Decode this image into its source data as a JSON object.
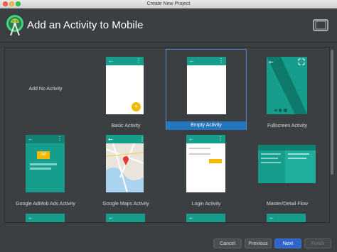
{
  "window": {
    "title": "Create New Project"
  },
  "header": {
    "title": "Add an Activity to Mobile"
  },
  "tiles": [
    {
      "label": "Add No Activity"
    },
    {
      "label": "Basic Activity"
    },
    {
      "label": "Empty Activity",
      "selected": true
    },
    {
      "label": "Fullscreen Activity"
    },
    {
      "label": "Google AdMob Ads Activity",
      "ad_text": "Ad"
    },
    {
      "label": "Google Maps Activity"
    },
    {
      "label": "Login Activity"
    },
    {
      "label": "Master/Detail Flow"
    }
  ],
  "buttons": {
    "cancel": "Cancel",
    "previous": "Previous",
    "next": "Next",
    "finish": "Finish"
  },
  "colors": {
    "accent": "#169d8c",
    "selection": "#2675bf",
    "fab": "#f5b800",
    "background": "#3c3f41"
  }
}
